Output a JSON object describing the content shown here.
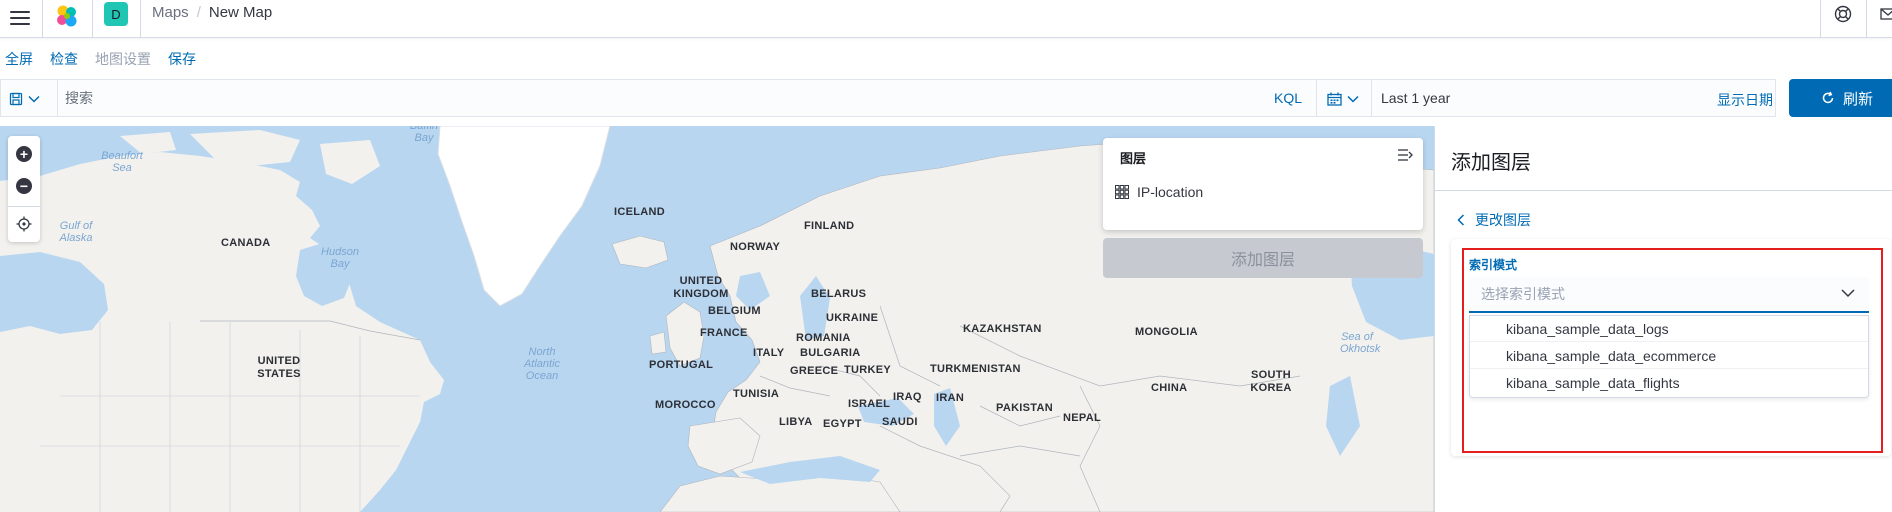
{
  "header": {
    "space_initial": "D",
    "breadcrumbs": [
      "Maps",
      "New Map"
    ],
    "breadcrumb_separator": "/"
  },
  "topnav": {
    "items": [
      "全屏",
      "检查",
      "地图设置",
      "保存"
    ]
  },
  "querybar": {
    "search_placeholder": "搜索",
    "language_toggle": "KQL"
  },
  "timepicker": {
    "value": "Last 1 year",
    "show_dates": "显示日期"
  },
  "refresh": {
    "label": "刷新",
    "color": "#006bb4"
  },
  "map": {
    "country_labels": [
      "ICELAND",
      "FINLAND",
      "CANADA",
      "NORWAY",
      "UNITED KINGDOM",
      "BELARUS",
      "BELGIUM",
      "UKRAINE",
      "FRANCE",
      "KAZAKHSTAN",
      "MONGOLIA",
      "ITALY",
      "BULGARIA",
      "ROMANIA",
      "UNITED STATES",
      "PORTUGAL",
      "GREECE",
      "TURKEY",
      "TURKMENISTAN",
      "SOUTH KOREA",
      "CHINA",
      "TUNISIA",
      "IRAQ",
      "IRAN",
      "MOROCCO",
      "ISRAEL",
      "PAKISTAN",
      "NEPAL",
      "LIBYA",
      "EGYPT",
      "SAUDI"
    ],
    "sea_labels": [
      "Baffin Bay",
      "Beaufort Sea",
      "Gulf of Alaska",
      "Hudson Bay",
      "North Atlantic Ocean",
      "Sea of Okhotsk"
    ]
  },
  "layer_panel": {
    "title": "图层",
    "layers": [
      {
        "name": "IP-location"
      }
    ],
    "add_layer_label": "添加图层"
  },
  "flyout": {
    "title": "添加图层",
    "back_link": "更改图层",
    "index_pattern_label": "索引模式",
    "index_pattern_placeholder": "选择索引模式",
    "options": [
      "kibana_sample_data_logs",
      "kibana_sample_data_ecommerce",
      "kibana_sample_data_flights"
    ],
    "highlight_color": "#e41e1e"
  }
}
